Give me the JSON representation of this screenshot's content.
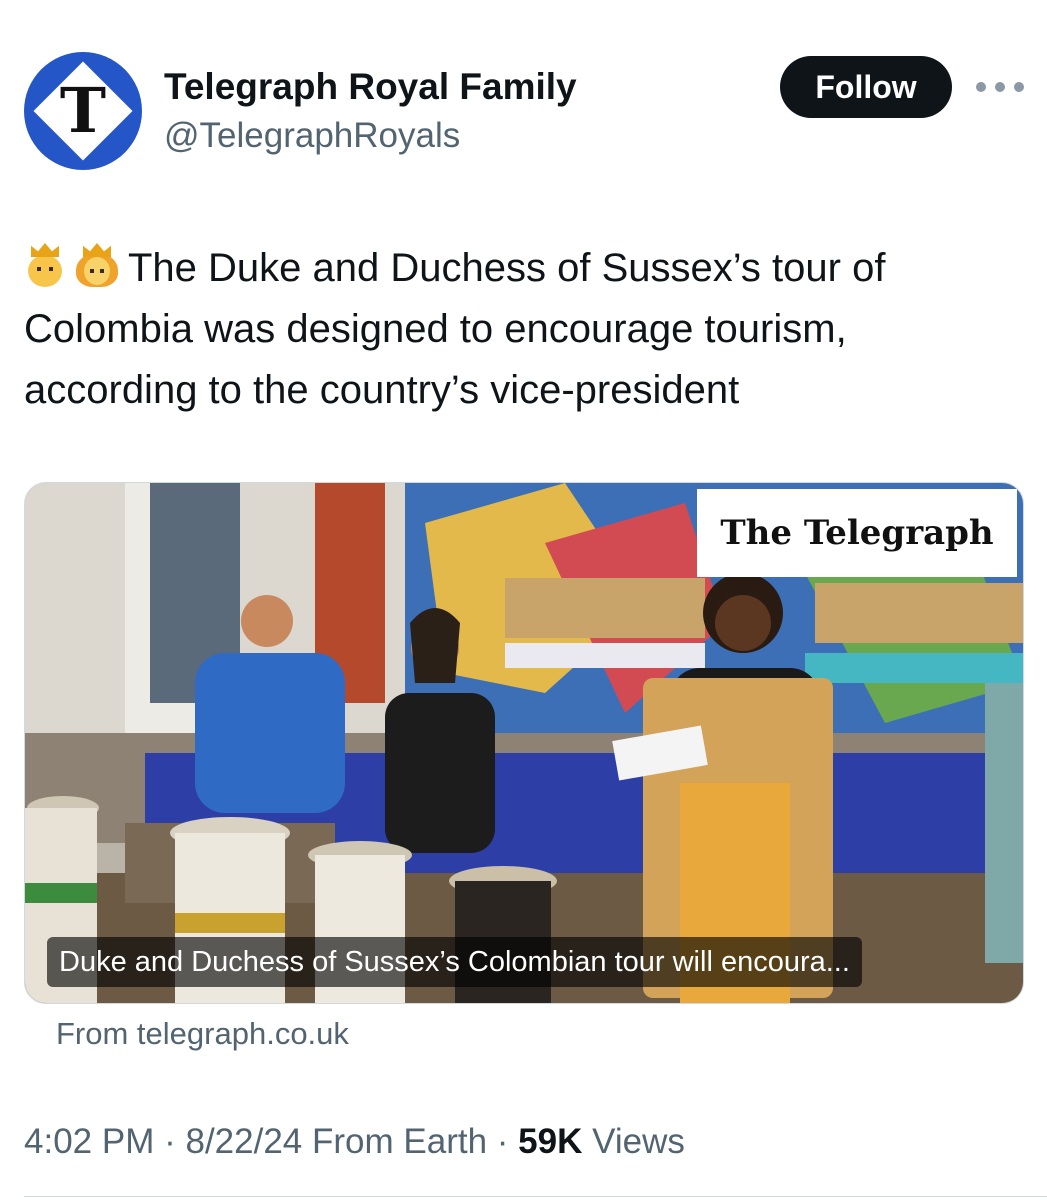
{
  "header": {
    "display_name": "Telegraph Royal Family",
    "handle": "@TelegraphRoyals",
    "avatar_letter": "T",
    "follow_label": "Follow",
    "more_icon": "more-horizontal-icon"
  },
  "tweet": {
    "emojis": [
      "prince-emoji",
      "princess-emoji"
    ],
    "text": "The Duke and Duchess of Sussex’s tour of Colombia was designed to encourage tourism, according to the country’s vice-president"
  },
  "card": {
    "brand": "The Telegraph",
    "caption": "Duke and Duchess of Sussex’s Colombian tour will encoura...",
    "source": "From telegraph.co.uk"
  },
  "meta": {
    "time": "4:02 PM",
    "sep1": "·",
    "date": "8/22/24",
    "origin": "From Earth",
    "sep2": "·",
    "views_count": "59K",
    "views_label": "Views"
  },
  "colors": {
    "text": "#0f1419",
    "secondary": "#536471",
    "avatar_blue": "#2456c8",
    "button_bg": "#0f1419"
  }
}
